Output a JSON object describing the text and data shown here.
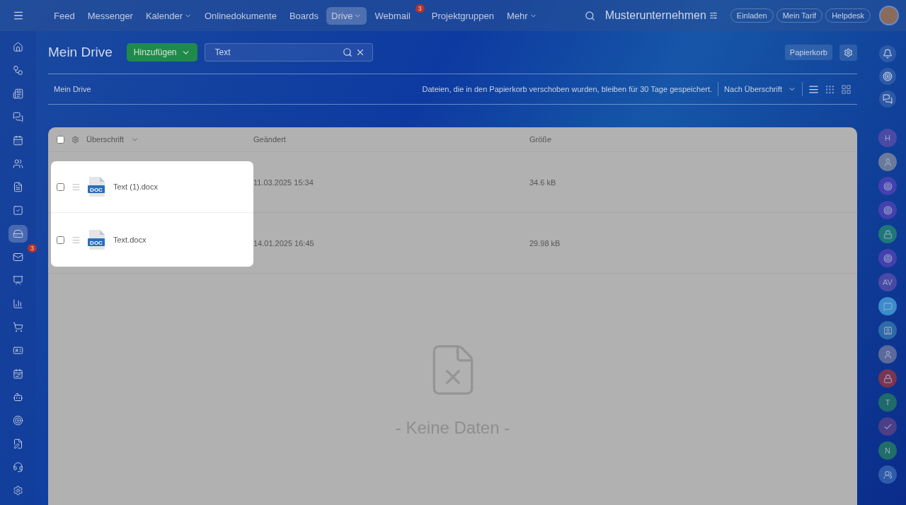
{
  "top_nav": {
    "items": [
      {
        "label": "Feed",
        "selected": false,
        "dropdown": false
      },
      {
        "label": "Messenger",
        "selected": false,
        "dropdown": false
      },
      {
        "label": "Kalender",
        "selected": false,
        "dropdown": true
      },
      {
        "label": "Onlinedokumente",
        "selected": false,
        "dropdown": false
      },
      {
        "label": "Boards",
        "selected": false,
        "dropdown": false
      },
      {
        "label": "Drive",
        "selected": true,
        "dropdown": true
      },
      {
        "label": "Webmail",
        "selected": false,
        "dropdown": false,
        "badge": "3"
      },
      {
        "label": "Projektgruppen",
        "selected": false,
        "dropdown": false
      },
      {
        "label": "Mehr",
        "selected": false,
        "dropdown": true
      }
    ],
    "company": "Musterunternehmen",
    "buttons": [
      "Einladen",
      "Mein Tarif",
      "Helpdesk"
    ]
  },
  "sidebar": {
    "items": [
      {
        "kind": "home",
        "selected": false
      },
      {
        "kind": "flow",
        "selected": false
      },
      {
        "kind": "news",
        "selected": false
      },
      {
        "kind": "chat",
        "selected": false
      },
      {
        "kind": "calendar",
        "selected": false
      },
      {
        "kind": "users",
        "selected": false
      },
      {
        "kind": "doc",
        "selected": false
      },
      {
        "kind": "task",
        "selected": false
      },
      {
        "kind": "drive",
        "selected": true
      },
      {
        "kind": "mail",
        "selected": false,
        "badge": "3"
      },
      {
        "kind": "board",
        "selected": false
      },
      {
        "kind": "chart",
        "selected": false
      },
      {
        "kind": "cart",
        "selected": false
      },
      {
        "kind": "cards",
        "selected": false
      },
      {
        "kind": "schedule",
        "selected": false
      },
      {
        "kind": "bot",
        "selected": false
      },
      {
        "kind": "target",
        "selected": false
      },
      {
        "kind": "edit",
        "selected": false
      },
      {
        "kind": "headset",
        "selected": false
      },
      {
        "kind": "settings",
        "selected": false
      }
    ]
  },
  "header": {
    "title": "Mein Drive",
    "add_button": "Hinzufügen",
    "search": {
      "value": "Text"
    },
    "trash_button": "Papierkorb"
  },
  "toolbar": {
    "breadcrumb": "Mein Drive",
    "notice": "Dateien, die in den Papierkorb verschoben wurden, bleiben für 30 Tage gespeichert.",
    "sort": "Nach Überschrift",
    "views": [
      {
        "kind": "list",
        "selected": true
      },
      {
        "kind": "dots",
        "selected": false
      },
      {
        "kind": "tiles",
        "selected": false
      }
    ]
  },
  "table": {
    "columns": [
      "Überschrift",
      "Geändert",
      "Größe"
    ],
    "all_checked": false,
    "rows": [
      {
        "name": "Text (1).docx",
        "file_type": "DOC",
        "modified": "11.03.2025 15:34",
        "size": "34.6 kB",
        "checked": false
      },
      {
        "name": "Text.docx",
        "file_type": "DOC",
        "modified": "14.01.2025 16:45",
        "size": "29.98 kB",
        "checked": false
      }
    ],
    "empty_text": "- Keine Daten -"
  },
  "right_rail": {
    "items": [
      {
        "kind": "letter",
        "text": "H",
        "color": "#4a4aa6"
      },
      {
        "kind": "photo",
        "color": "#6a7a9a"
      },
      {
        "kind": "copilot",
        "color": "#4440b0"
      },
      {
        "kind": "copilot",
        "color": "#4440b0"
      },
      {
        "kind": "lock",
        "color": "#1f7878"
      },
      {
        "kind": "copilot",
        "color": "#4440b0"
      },
      {
        "kind": "letter",
        "text": "AV",
        "color": "#4a4aa6"
      },
      {
        "kind": "chat",
        "color": "#3a8ccc"
      },
      {
        "kind": "card",
        "color": "#2d6aa6"
      },
      {
        "kind": "photo",
        "color": "#5a6a9a"
      },
      {
        "kind": "lock",
        "color": "#7a3550"
      },
      {
        "kind": "letter",
        "text": "T",
        "color": "#1f6a6a"
      },
      {
        "kind": "check",
        "color": "#4a3f88"
      },
      {
        "kind": "letter",
        "text": "N",
        "color": "#1f6e68"
      },
      {
        "kind": "people",
        "color": "#2d5cab"
      }
    ]
  }
}
